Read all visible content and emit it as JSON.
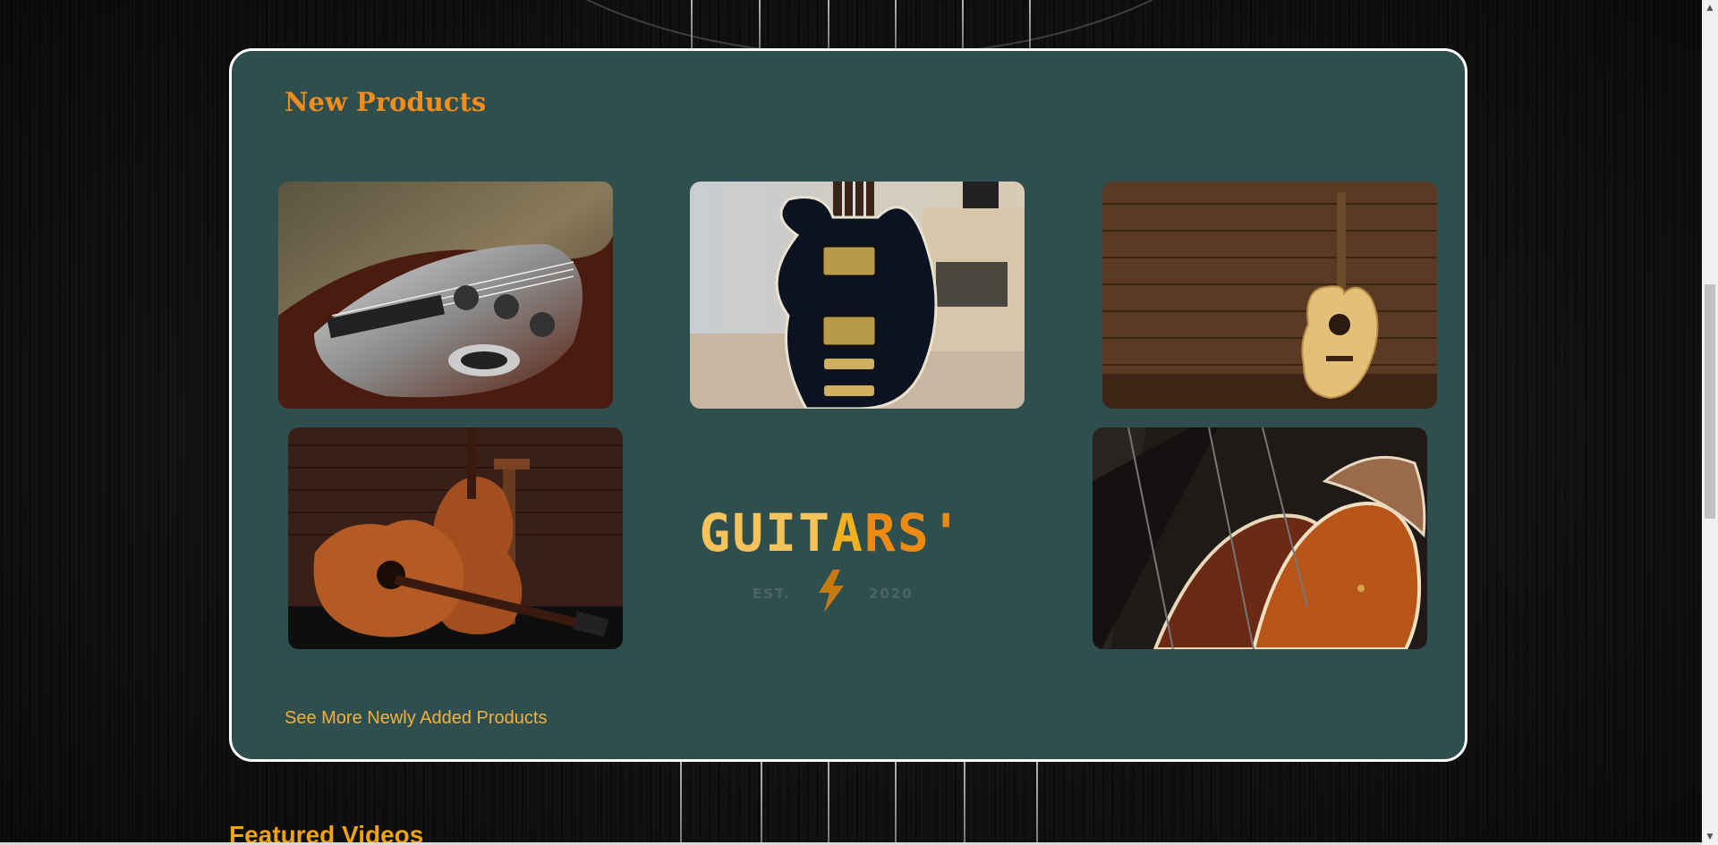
{
  "new_products": {
    "title": "New Products",
    "products": [
      {
        "image": "electric-guitar-closeup",
        "alt": "Sunburst electric guitar close-up"
      },
      {
        "image": "black-les-paul-guitar",
        "alt": "Black electric guitar with gold hardware"
      },
      {
        "image": "acoustic-guitar-wood-wall",
        "alt": "Acoustic guitar against wooden wall"
      },
      {
        "image": "two-acoustic-guitars",
        "alt": "Two mahogany acoustic guitars"
      },
      {
        "image": "guitar-bodies-row",
        "alt": "Row of hollow-body guitars"
      }
    ],
    "logo": {
      "word_part1": "GUIT",
      "word_part2": "A",
      "word_part3": "RS'",
      "est_label": "EST.",
      "year": "2020",
      "bolt_icon": "lightning-bolt-icon"
    },
    "see_more_label": "See More Newly Added Products"
  },
  "featured_videos": {
    "title": "Featured Videos"
  },
  "colors": {
    "panel_bg": "#2f4f4f",
    "panel_border": "#ffffff",
    "accent_orange": "#f28c1b",
    "link_color": "#f5b03a"
  }
}
